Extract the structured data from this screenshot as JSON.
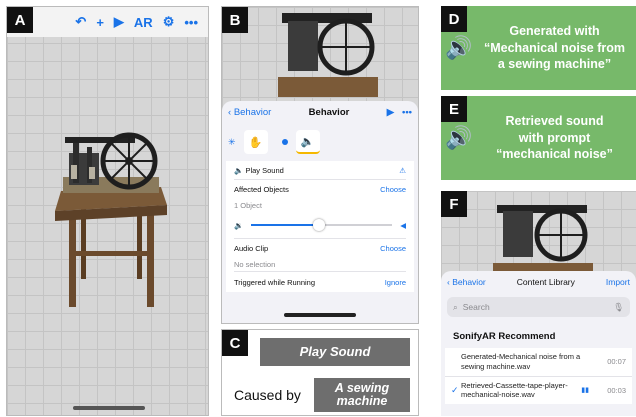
{
  "labels": {
    "a": "A",
    "b": "B",
    "c": "C",
    "d": "D",
    "e": "E",
    "f": "F"
  },
  "panel_a": {
    "toolbar": {
      "undo_icon": "↶",
      "add_icon": "+",
      "play_icon": "▶",
      "ar_label": "AR",
      "settings_icon": "⚙",
      "more_icon": "•••"
    }
  },
  "panel_b": {
    "nav": {
      "back_label": "Behavior",
      "title": "Behavior",
      "play_icon": "▶",
      "more_icon": "•••"
    },
    "action": {
      "title": "Play Sound"
    },
    "affected": {
      "label": "Affected Objects",
      "action": "Choose",
      "count": "1 Object"
    },
    "volume_level": 0.48,
    "audio_clip": {
      "label": "Audio Clip",
      "action": "Choose",
      "value": "No selection"
    },
    "triggered": {
      "label": "Triggered while Running",
      "action": "Ignore"
    }
  },
  "panel_c": {
    "action_box": "Play Sound",
    "caused_by": "Caused by",
    "cause_box": "A sewing machine"
  },
  "panel_d": {
    "line1": "Generated with",
    "line2": "“Mechanical noise from",
    "line3": "a sewing machine”"
  },
  "panel_e": {
    "line1": "Retrieved sound",
    "line2": "with prompt",
    "line3": "“mechanical noise”"
  },
  "panel_f": {
    "nav": {
      "back_label": "Behavior",
      "title": "Content Library",
      "action": "Import"
    },
    "search_placeholder": "Search",
    "section_title": "SonifyAR Recommend",
    "clips": [
      {
        "name": "Generated-Mechanical noise from a sewing machine.wav",
        "duration": "00:07",
        "selected": false
      },
      {
        "name": "Retrieved-Cassette-tape-player-mechanical-noise.wav",
        "duration": "00:03",
        "selected": true
      }
    ]
  },
  "colors": {
    "accent": "#1a73e8",
    "green_panel": "#77b96a",
    "caption_box": "#6e6e6e"
  }
}
